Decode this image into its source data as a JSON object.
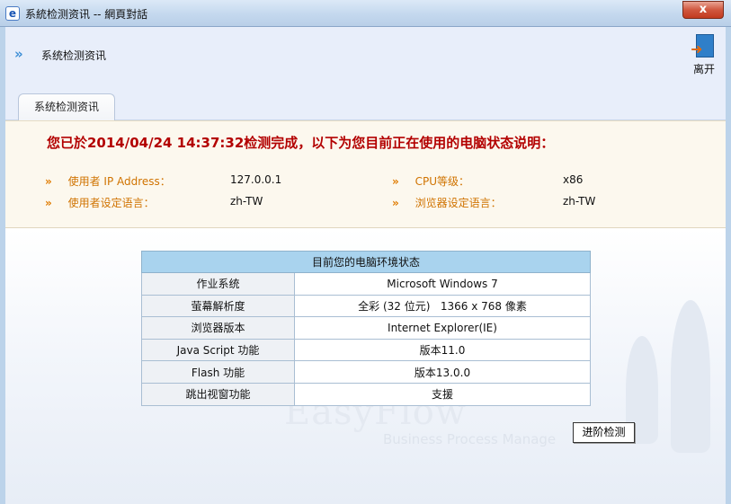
{
  "window": {
    "title": "系統检测资讯 -- 網頁對話",
    "app_icon": "ie-icon",
    "close_label": "x"
  },
  "header": {
    "title": "系统检测资讯",
    "exit_label": "离开",
    "exit_icon": "exit-door-icon"
  },
  "tab": {
    "label": "系统检测资讯"
  },
  "status": {
    "headline": "您已於2014/04/24 14:37:32检测完成，以下为您目前正在使用的电脑状态说明：",
    "items": [
      {
        "label": "使用者 IP Address：",
        "value": "127.0.0.1"
      },
      {
        "label": "CPU等级：",
        "value": "x86"
      },
      {
        "label": "使用者设定语言：",
        "value": "zh-TW"
      },
      {
        "label": "浏览器设定语言：",
        "value": "zh-TW"
      }
    ]
  },
  "env_table": {
    "title": "目前您的电脑环境状态",
    "rows": [
      {
        "key": "作业系统",
        "value": "Microsoft Windows 7"
      },
      {
        "key": "萤幕解析度",
        "value": "全彩 (32 位元)   1366 x 768 像素"
      },
      {
        "key": "浏览器版本",
        "value": "Internet Explorer(IE)"
      },
      {
        "key": "Java Script 功能",
        "value": "版本11.0"
      },
      {
        "key": "Flash 功能",
        "value": "版本13.0.0"
      },
      {
        "key": "跳出视窗功能",
        "value": "支援"
      }
    ]
  },
  "advanced_button": {
    "label": "进阶检测"
  },
  "watermark": {
    "brand": "EasyFlow",
    "tagline": "Business Process Manage"
  },
  "colors": {
    "headline": "#b30000",
    "label_orange": "#d07300",
    "table_header": "#a9d3ee"
  }
}
